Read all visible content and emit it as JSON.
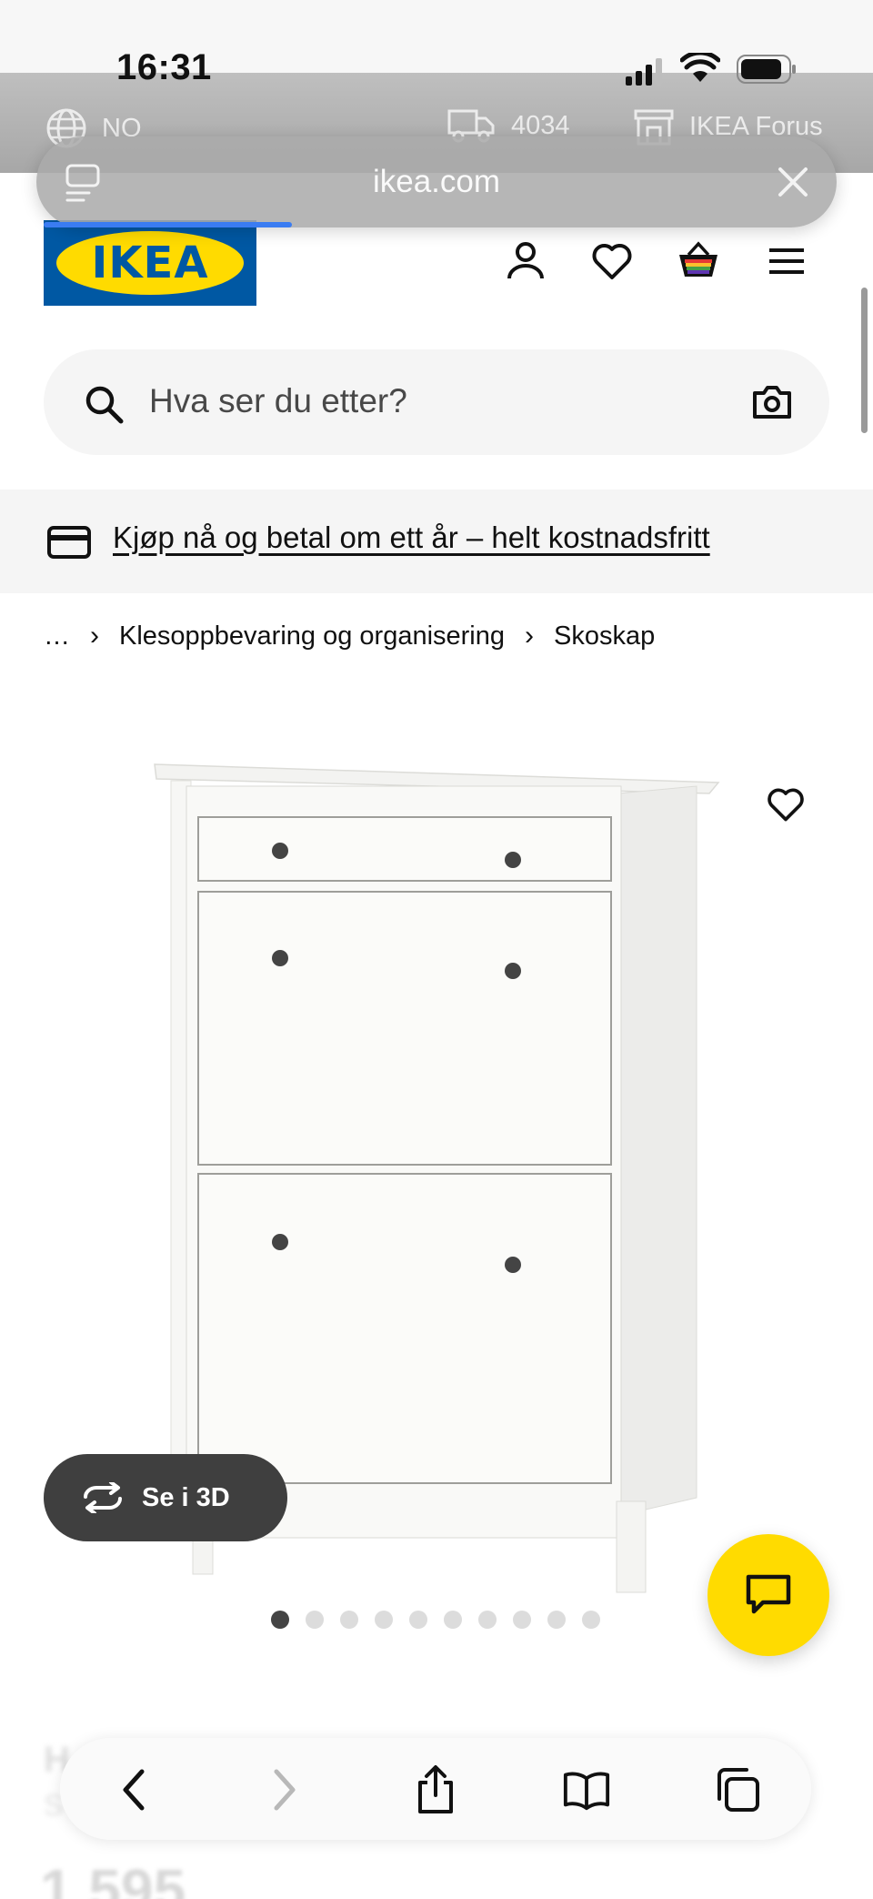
{
  "status_bar": {
    "time": "16:31"
  },
  "top_strip": {
    "language": "NO",
    "postal_code": "4034",
    "store": "IKEA Forus"
  },
  "url_bar": {
    "domain": "ikea.com",
    "load_progress_percent": 31
  },
  "header": {
    "logo_text": "IKEA",
    "brand_blue": "#0058a3",
    "brand_yellow": "#ffdb00"
  },
  "search": {
    "placeholder": "Hva ser du etter?"
  },
  "promo": {
    "text": "Kjøp nå og betal om ett år – helt kostnadsfritt"
  },
  "breadcrumb": {
    "items": [
      "…",
      "Klesoppbevaring og organisering",
      "Skoskap"
    ]
  },
  "product": {
    "view_3d_label": "Se i 3D",
    "image_count": 10,
    "active_image_index": 0,
    "name_partial": "H",
    "sub_partial": "S",
    "price_partial": "1 595"
  }
}
